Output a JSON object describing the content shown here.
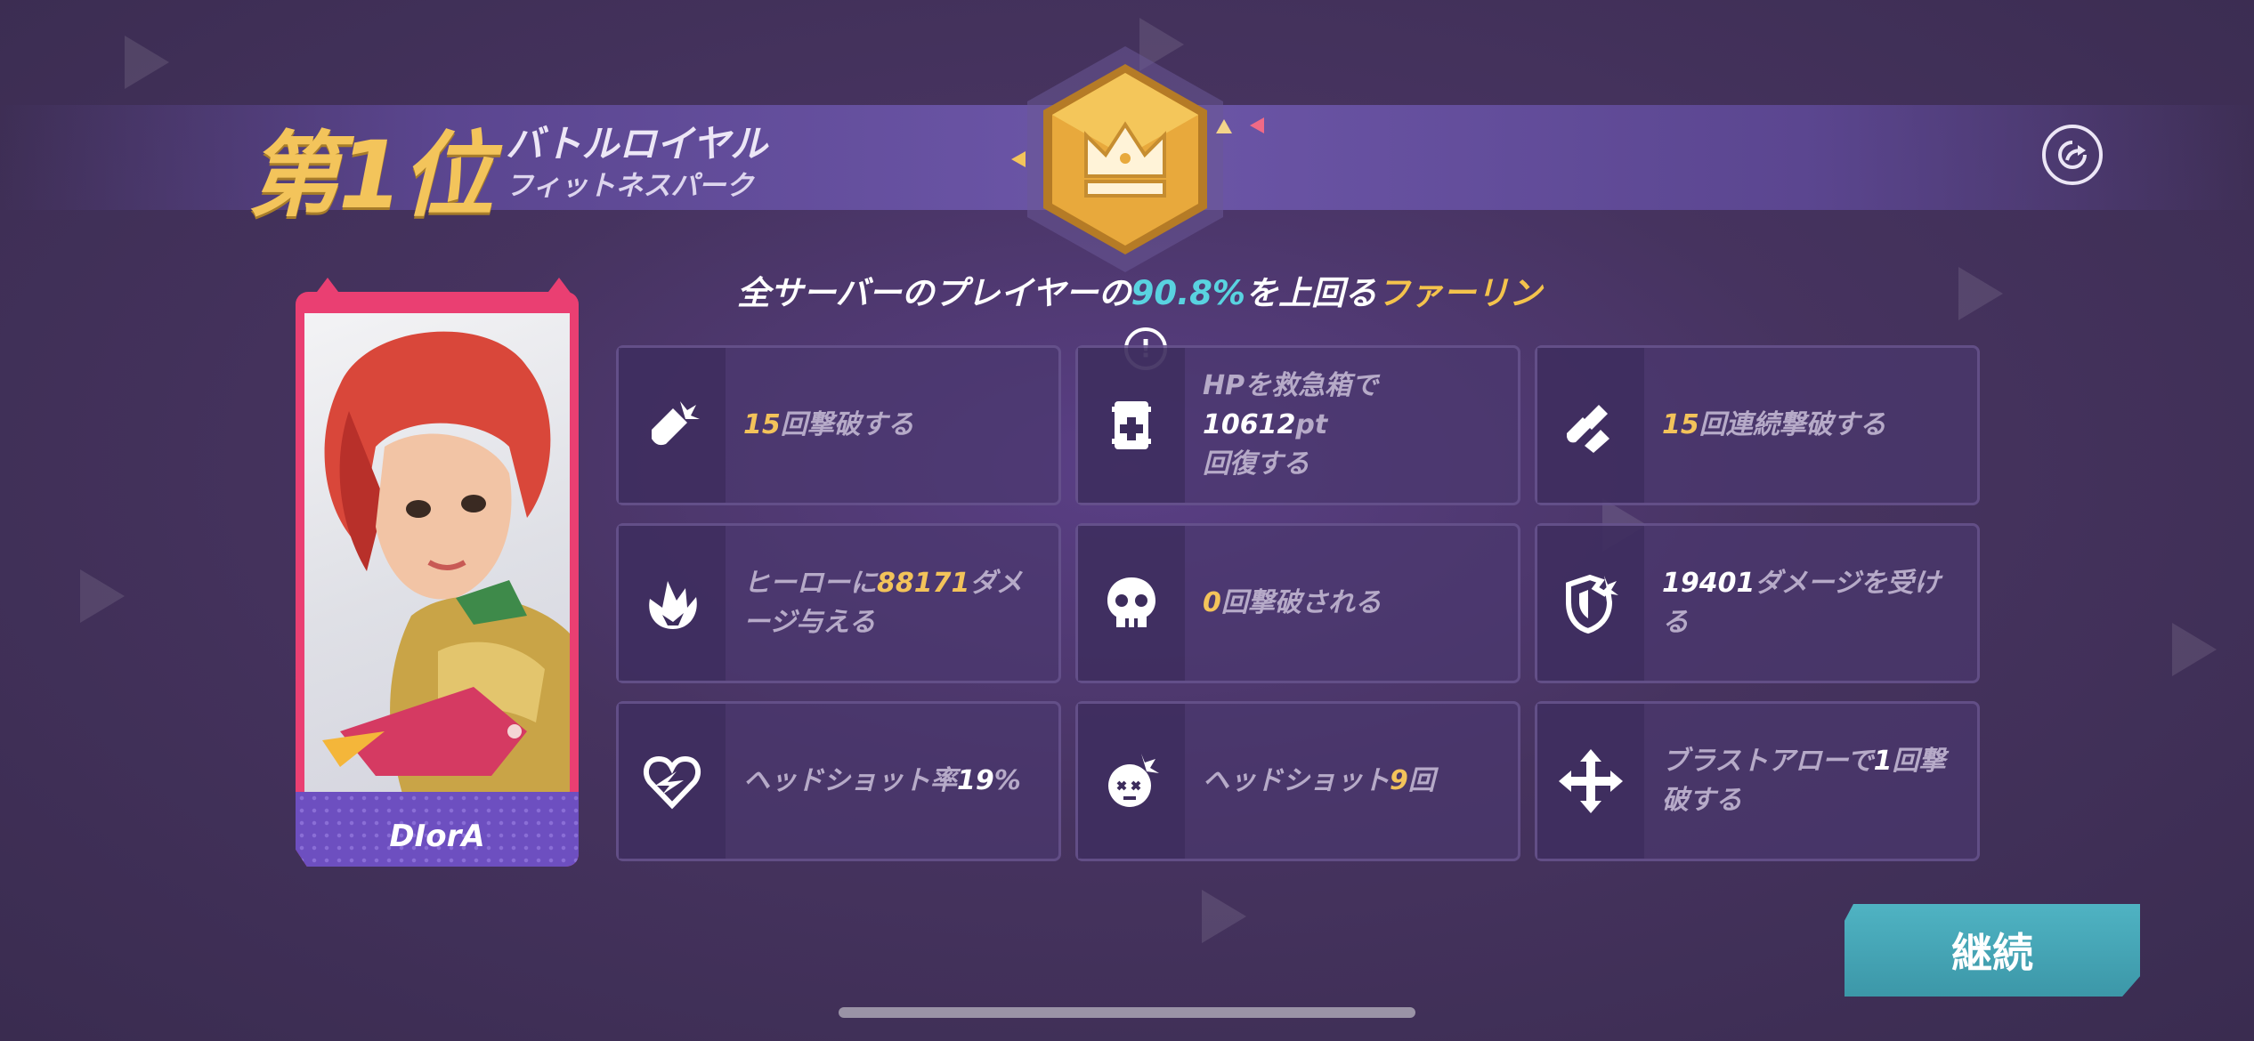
{
  "header": {
    "rank": "第1位",
    "mode": "バトルロイヤル",
    "map": "フィットネスパーク"
  },
  "tagline": {
    "prefix": "全サーバーのプレイヤーの",
    "percent": "90.8%",
    "middle": "を上回る",
    "family": "ファーリン",
    "info_glyph": "!"
  },
  "hero": {
    "name": "DIorA"
  },
  "stats": [
    {
      "icon": "bullet-kill-icon",
      "num": "15",
      "text": "回撃破する"
    },
    {
      "icon": "medkit-icon",
      "pre": "HPを救急箱で",
      "num": "10612",
      "text": "pt\n回復する"
    },
    {
      "icon": "multi-bullet-icon",
      "num": "15",
      "text": "回連続撃破する"
    },
    {
      "icon": "flame-damage-icon",
      "pre": "ヒーローに",
      "num": "88171",
      "text": "ダメージ与える"
    },
    {
      "icon": "skull-icon",
      "num": "0",
      "text": "回撃破される"
    },
    {
      "icon": "shield-hit-icon",
      "num": "19401",
      "text": "ダメージを受ける"
    },
    {
      "icon": "broken-heart-icon",
      "pre": "ヘッドショット率",
      "num": "19",
      "text": "%"
    },
    {
      "icon": "headshot-icon",
      "pre": "ヘッドショット",
      "num": "9",
      "text": "回"
    },
    {
      "icon": "arrows-cross-icon",
      "pre": "ブラストアローで",
      "num": "1",
      "text": "回撃破する"
    }
  ],
  "continue_label": "継続",
  "colors": {
    "gold": "#f3c45b",
    "cyan": "#59d3e0",
    "button": "#45a6b6",
    "card": "#ea3f72"
  }
}
